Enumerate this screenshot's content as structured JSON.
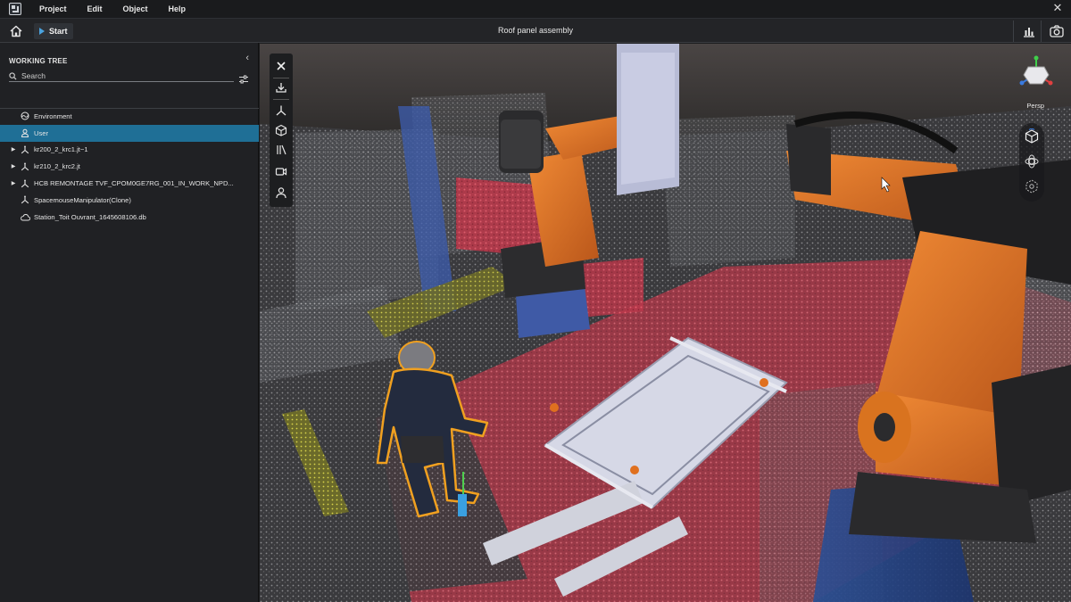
{
  "menubar": {
    "items": [
      "Project",
      "Edit",
      "Object",
      "Help"
    ],
    "close_glyph": "✕"
  },
  "toolbar": {
    "start_label": "Start",
    "document_title": "Roof panel assembly",
    "icons": [
      "home-icon",
      "play-icon",
      "statistics-icon",
      "camera-icon"
    ]
  },
  "sidebar": {
    "title": "WORKING TREE",
    "collapse_glyph": "‹",
    "search_placeholder": "Search",
    "tree": [
      {
        "label": "Environment",
        "icon": "environment-icon",
        "expandable": false,
        "selected": false
      },
      {
        "label": "User",
        "icon": "user-icon",
        "expandable": false,
        "selected": true
      },
      {
        "label": "kr200_2_krc1.jt~1",
        "icon": "axes-icon",
        "expandable": true,
        "selected": false
      },
      {
        "label": "kr210_2_krc2.jt",
        "icon": "axes-icon",
        "expandable": true,
        "selected": false
      },
      {
        "label": "HCB REMONTAGE TVF_CPOM0GE7RG_001_IN_WORK_NPD...",
        "icon": "axes-icon",
        "expandable": true,
        "selected": false
      },
      {
        "label": "SpacemouseManipulator(Clone)",
        "icon": "axes-icon",
        "expandable": false,
        "selected": false
      },
      {
        "label": "Station_Toit Ouvrant_1645608106.db",
        "icon": "cloud-icon",
        "expandable": false,
        "selected": false
      }
    ]
  },
  "viewport": {
    "view_mode": "Persp",
    "left_tools": [
      "close-icon",
      "download-icon",
      "axes-icon",
      "cube-icon",
      "measure-icon",
      "video-camera-icon",
      "user-icon"
    ],
    "right_tools": [
      "cube-view-icon",
      "orbit-icon",
      "explode-icon"
    ],
    "colors": {
      "robot_orange": "#e0701f",
      "selection_outline": "#f0a020",
      "accent_blue": "#1f6f96"
    }
  }
}
